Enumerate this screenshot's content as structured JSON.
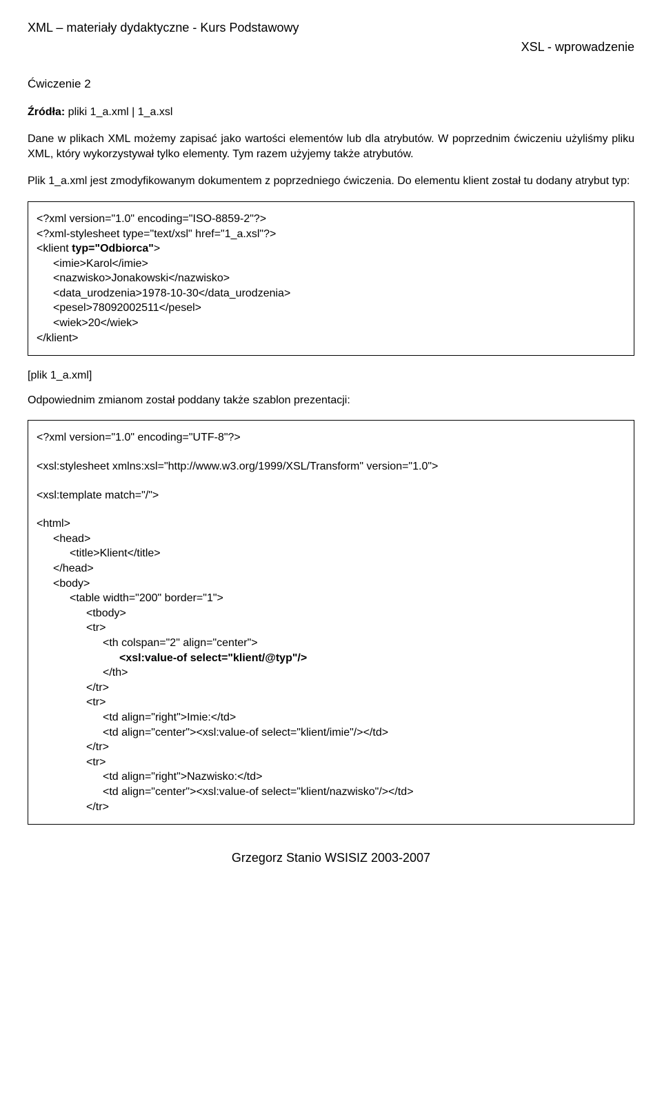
{
  "header": {
    "left": "XML – materiały dydaktyczne - Kurs Podstawowy",
    "right": "XSL - wprowadzenie"
  },
  "exercise_title": "Ćwiczenie 2",
  "sources_label": "Źródła:",
  "sources_value": " pliki 1_a.xml | 1_a.xsl",
  "para1": "Dane w plikach XML możemy zapisać jako wartości elementów lub dla atrybutów. W poprzednim ćwiczeniu użyliśmy pliku XML, który wykorzystywał tylko elementy. Tym razem użyjemy także atrybutów.",
  "para2": "Plik 1_a.xml jest zmodyfikowanym dokumentem z poprzedniego ćwiczenia. Do elementu klient został tu dodany atrybut typ:",
  "code1": {
    "l1": "<?xml version=\"1.0\" encoding=\"ISO-8859-2\"?>",
    "l2": "<?xml-stylesheet type=\"text/xsl\" href=\"1_a.xsl\"?>",
    "l3a": "<klient ",
    "l3b": "typ=\"Odbiorca\"",
    "l3c": ">",
    "l4": "<imie>Karol</imie>",
    "l5": "<nazwisko>Jonakowski</nazwisko>",
    "l6": "<data_urodzenia>1978-10-30</data_urodzenia>",
    "l7": "<pesel>78092002511</pesel>",
    "l8": "<wiek>20</wiek>",
    "l9": "</klient>"
  },
  "file_label": "[plik 1_a.xml]",
  "para3": "Odpowiednim zmianom został poddany także szablon prezentacji:",
  "code2": {
    "l1": "<?xml version=\"1.0\" encoding=\"UTF-8\"?>",
    "l2": "<xsl:stylesheet xmlns:xsl=\"http://www.w3.org/1999/XSL/Transform\" version=\"1.0\">",
    "l3": "<xsl:template match=\"/\">",
    "l4": "<html>",
    "l5": "<head>",
    "l6": "<title>Klient</title>",
    "l7": "</head>",
    "l8": "<body>",
    "l9": "<table width=\"200\" border=\"1\">",
    "l10": "<tbody>",
    "l11": "<tr>",
    "l12": "<th colspan=\"2\" align=\"center\">",
    "l13": "<xsl:value-of select=\"klient/@typ\"/>",
    "l14": "</th>",
    "l15": "</tr>",
    "l16": "<tr>",
    "l17": "<td align=\"right\">Imie:</td>",
    "l18": "<td align=\"center\"><xsl:value-of select=\"klient/imie\"/></td>",
    "l19": "</tr>",
    "l20": "<tr>",
    "l21": "<td align=\"right\">Nazwisko:</td>",
    "l22": "<td align=\"center\"><xsl:value-of select=\"klient/nazwisko\"/></td>",
    "l23": "</tr>"
  },
  "footer": "Grzegorz Stanio WSISIZ 2003-2007"
}
